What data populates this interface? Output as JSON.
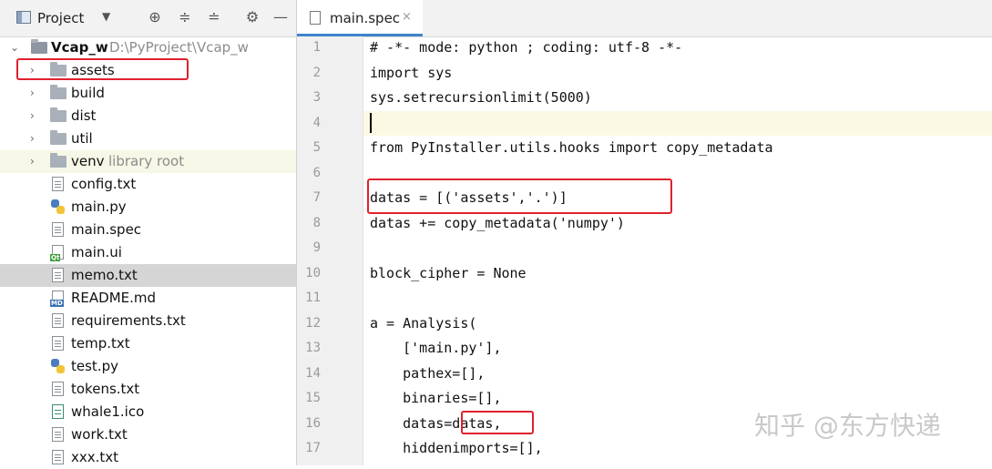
{
  "project_panel": {
    "title": "Project",
    "caret": "▼",
    "tools": [
      "⊕",
      "≑",
      "≐",
      "⚙",
      "—"
    ]
  },
  "tree": {
    "root_name": "Vcap_w",
    "root_path": "D:\\PyProject\\Vcap_w",
    "folders": [
      "assets",
      "build",
      "dist",
      "util"
    ],
    "venv_name": "venv",
    "venv_hint": "library root",
    "files": [
      "config.txt",
      "main.py",
      "main.spec",
      "main.ui",
      "memo.txt",
      "README.md",
      "requirements.txt",
      "temp.txt",
      "test.py",
      "tokens.txt",
      "whale1.ico",
      "work.txt",
      "xxx.txt"
    ],
    "badges": {
      "qt": "Qt",
      "md": "MD"
    }
  },
  "editor": {
    "tab_label": "main.spec",
    "tab_close": "×",
    "line_numbers": [
      "1",
      "2",
      "3",
      "4",
      "5",
      "6",
      "7",
      "8",
      "9",
      "10",
      "11",
      "12",
      "13",
      "14",
      "15",
      "16",
      "17"
    ],
    "lines": [
      "# -*- mode: python ; coding: utf-8 -*-",
      "import sys",
      "sys.setrecursionlimit(5000)",
      "",
      "from PyInstaller.utils.hooks import copy_metadata",
      "",
      "datas = [('assets','.')]",
      "datas += copy_metadata('numpy')",
      "",
      "block_cipher = None",
      "",
      "a = Analysis(",
      "    ['main.py'],",
      "    pathex=[],",
      "    binaries=[],",
      "    datas=datas,",
      "    hiddenimports=[],"
    ]
  },
  "watermark": "知乎 @东方快递",
  "colors": {
    "accent": "#4083c9",
    "highlight": "#e0212e"
  }
}
